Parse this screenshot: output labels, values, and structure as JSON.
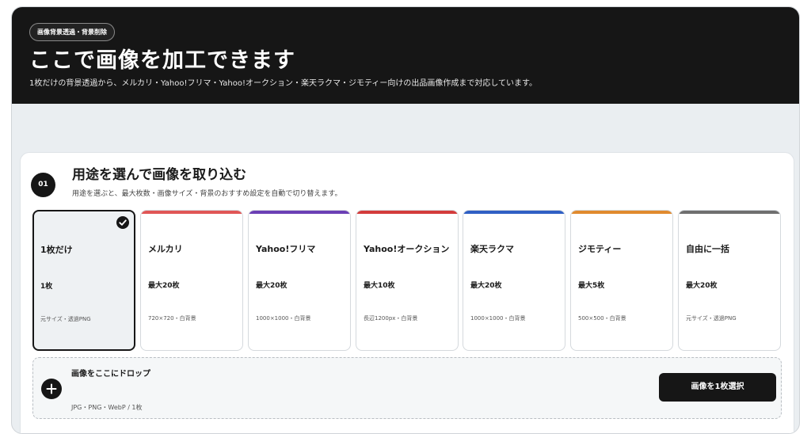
{
  "hero": {
    "pill": "画像背景透過・背景削除",
    "title": "ここで画像を加工できます",
    "subtitle": "1枚だけの背景透過から、メルカリ・Yahoo!フリマ・Yahoo!オークション・楽天ラクマ・ジモティー向けの出品画像作成まで対応しています。"
  },
  "step": {
    "number": "01",
    "title": "用途を選んで画像を取り込む",
    "description": "用途を選ぶと、最大枚数・画像サイズ・背景のおすすめ設定を自動で切り替えます。"
  },
  "cards": [
    {
      "name": "1枚だけ",
      "count": "1枚",
      "spec": "元サイズ・透過PNG",
      "accent": "#161616",
      "selected": true
    },
    {
      "name": "メルカリ",
      "count": "最大20枚",
      "spec": "720×720・白背景",
      "accent": "#e05656",
      "selected": false
    },
    {
      "name": "Yahoo!フリマ",
      "count": "最大20枚",
      "spec": "1000×1000・白背景",
      "accent": "#6b3fb5",
      "selected": false
    },
    {
      "name": "Yahoo!オークション",
      "count": "最大10枚",
      "spec": "長辺1200px・白背景",
      "accent": "#d33b3b",
      "selected": false
    },
    {
      "name": "楽天ラクマ",
      "count": "最大20枚",
      "spec": "1000×1000・白背景",
      "accent": "#2f5fc4",
      "selected": false
    },
    {
      "name": "ジモティー",
      "count": "最大5枚",
      "spec": "500×500・白背景",
      "accent": "#e08a2e",
      "selected": false
    },
    {
      "name": "自由に一括",
      "count": "最大20枚",
      "spec": "元サイズ・透過PNG",
      "accent": "#6f6f6f",
      "selected": false
    }
  ],
  "drop": {
    "title": "画像をここにドロップ",
    "hint": "JPG・PNG・WebP / 1枚",
    "button": "画像を1枚選択",
    "icon": "plus-icon"
  },
  "colors": {
    "dark": "#161616",
    "page_bg": "#eaeef1"
  }
}
